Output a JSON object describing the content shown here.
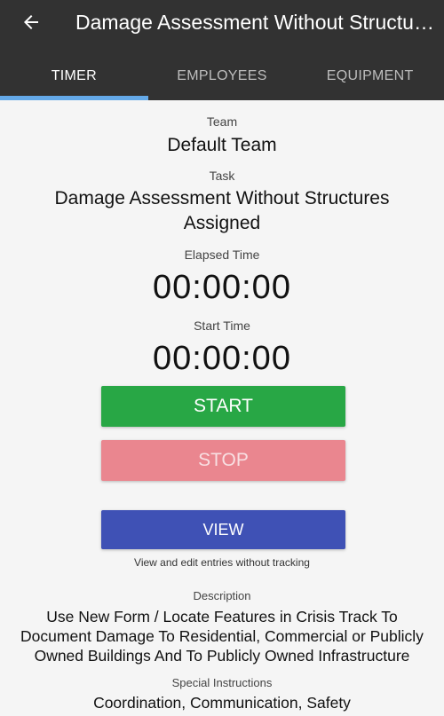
{
  "header": {
    "title": "Damage Assessment Without Structu…",
    "tabs": [
      {
        "label": "TIMER"
      },
      {
        "label": "EMPLOYEES"
      },
      {
        "label": "EQUIPMENT"
      }
    ]
  },
  "timer": {
    "team_label": "Team",
    "team_value": "Default Team",
    "task_label": "Task",
    "task_line1": "Damage Assessment Without Structures",
    "task_line2": "Assigned",
    "elapsed_label": "Elapsed Time",
    "elapsed_value": "00:00:00",
    "start_label": "Start Time",
    "start_value": "00:00:00",
    "start_button": "START",
    "stop_button": "STOP",
    "view_button": "VIEW",
    "view_hint": "View and edit entries without tracking",
    "description_label": "Description",
    "description_line1": "Use New Form / Locate Features in Crisis Track To",
    "description_line2": "Document Damage To Residential, Commercial or Publicly",
    "description_line3": "Owned Buildings And To Publicly Owned Infrastructure",
    "special_label": "Special Instructions",
    "special_value": "Coordination, Communication, Safety"
  },
  "colors": {
    "header_bg": "#323232",
    "tab_indicator": "#64a9e8",
    "start": "#28a745",
    "stop": "#ea868f",
    "view": "#3f51b5"
  },
  "icons": {
    "back": "arrow-left-icon"
  }
}
